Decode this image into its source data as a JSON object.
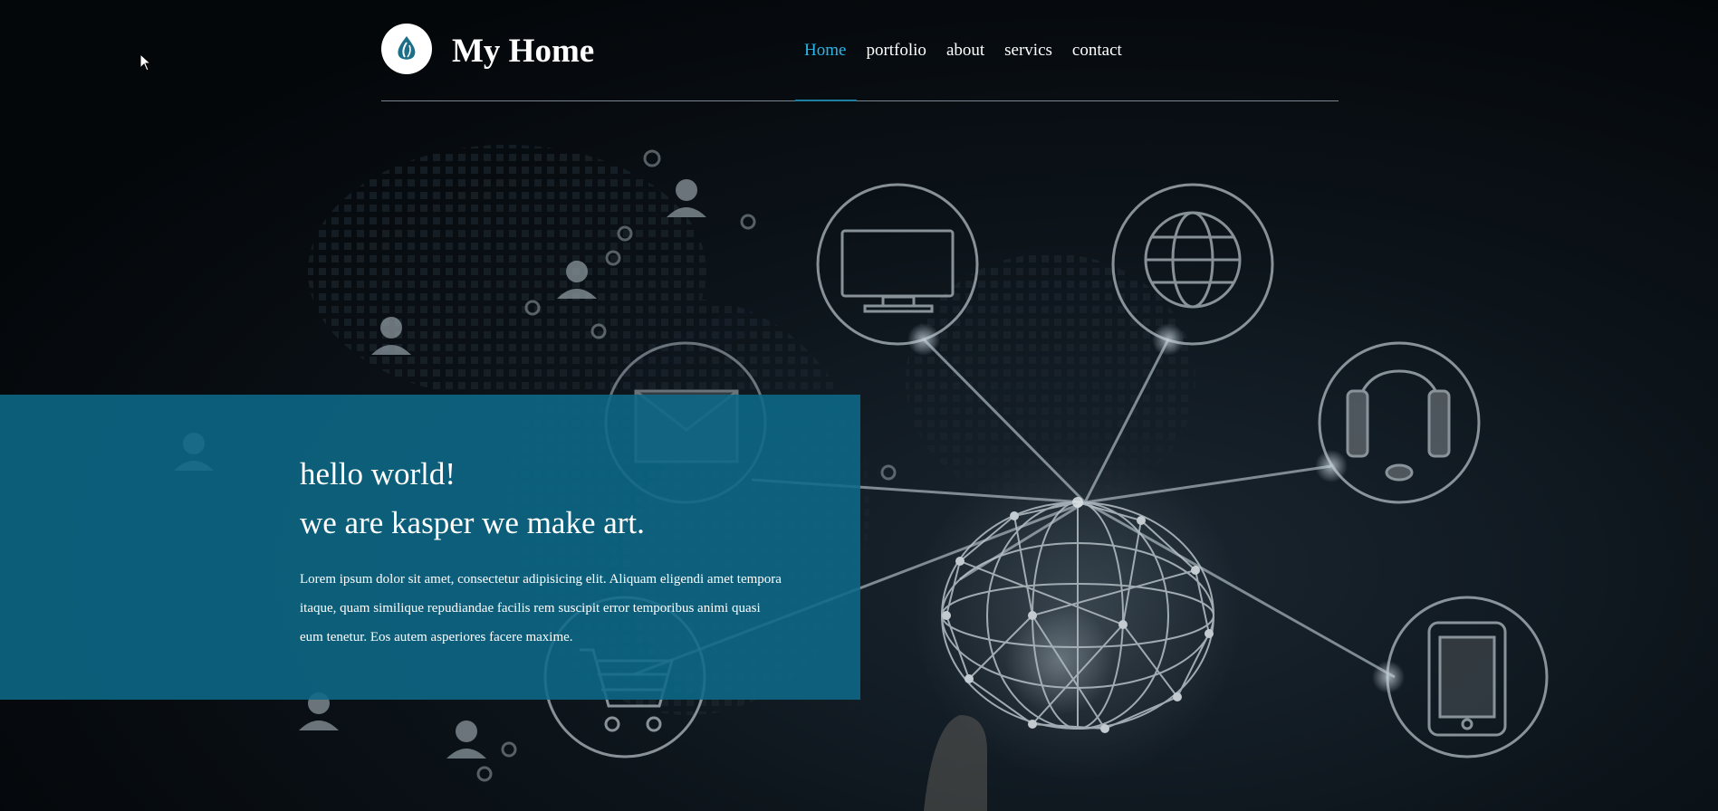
{
  "header": {
    "site_title": "My Home",
    "logo_icon": "drop-leaf-logo-icon",
    "nav": [
      {
        "label": "Home",
        "active": true
      },
      {
        "label": "portfolio",
        "active": false
      },
      {
        "label": "about",
        "active": false
      },
      {
        "label": "servics",
        "active": false
      },
      {
        "label": "contact",
        "active": false
      }
    ]
  },
  "hero": {
    "line1": "hello world!",
    "line2": "we are kasper we make art.",
    "paragraph_lines": [
      "Lorem ipsum dolor sit amet, consectetur adipisicing elit. Aliquam eligendi amet tempora",
      "itaque, quam similique repudiandae facilis rem suscipit error temporibus animi quasi",
      "eum tenetur. Eos autem asperiores facere maxime."
    ]
  },
  "colors": {
    "accent": "#2ab6e8",
    "hero_box": "#0c6988",
    "background": "#05090d"
  },
  "icons": {
    "background_icons": [
      "monitor-icon",
      "globe-icon",
      "headset-icon",
      "tablet-icon",
      "shopping-cart-icon",
      "envelope-icon",
      "person-icon",
      "network-sphere-icon"
    ],
    "cursor": "mouse-pointer-icon"
  }
}
